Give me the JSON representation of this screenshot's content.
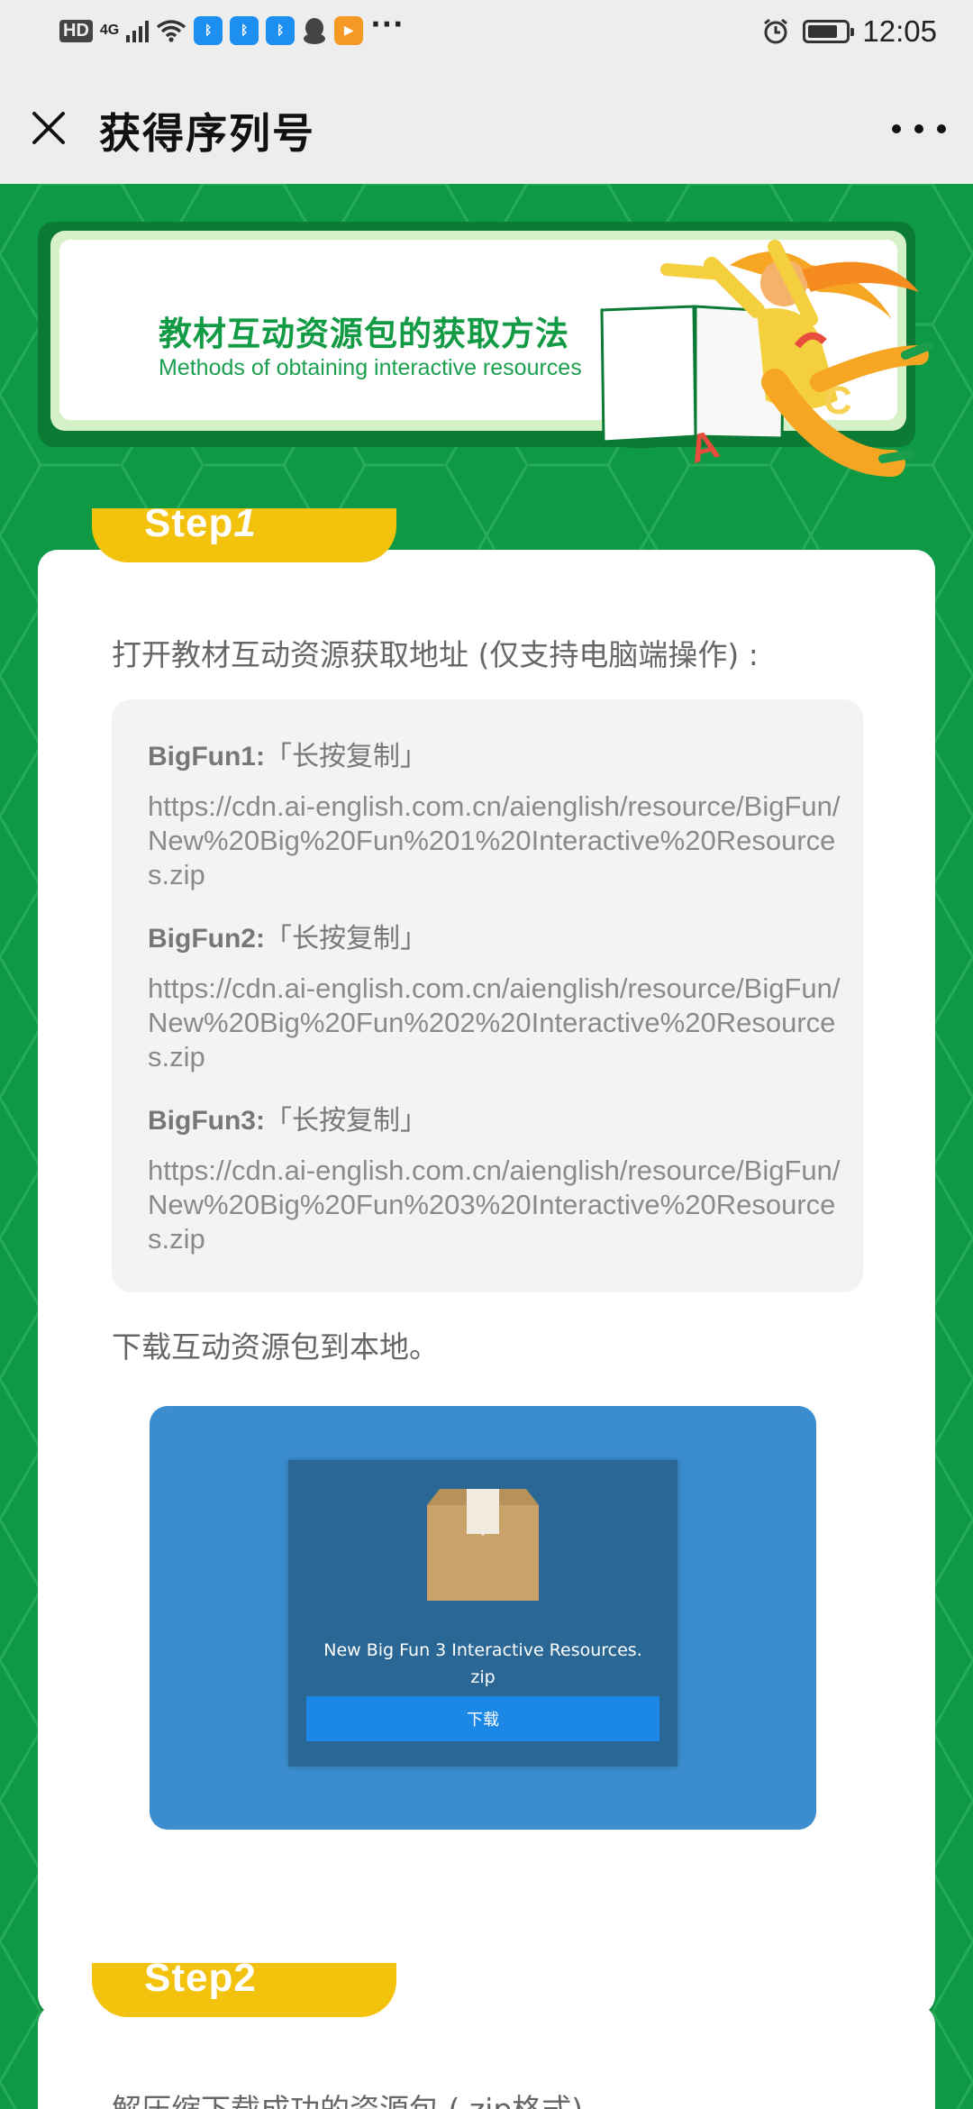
{
  "status_bar": {
    "left": {
      "hd": "HD",
      "network": "4G"
    },
    "app_badges": [
      "bluetooth-app-icon",
      "bluetooth-app-icon",
      "bluetooth-app-icon"
    ],
    "overflow": "···",
    "time": "12:05",
    "battery_level": 0.8
  },
  "nav": {
    "title": "获得序列号"
  },
  "banner": {
    "title": "教材互动资源包的获取方法",
    "subtitle": "Methods of obtaining interactive resources"
  },
  "step1": {
    "label_prefix": "Step",
    "label_number": "1",
    "intro": "打开教材互动资源获取地址 (仅支持电脑端操作) :",
    "links": [
      {
        "name": "BigFun1:",
        "hint": "「长按复制」",
        "url": "https://cdn.ai-english.com.cn/aienglish/resource/BigFun/New%20Big%20Fun%201%20Interactive%20Resources.zip"
      },
      {
        "name": "BigFun2:",
        "hint": "「长按复制」",
        "url": "https://cdn.ai-english.com.cn/aienglish/resource/BigFun/New%20Big%20Fun%202%20Interactive%20Resources.zip"
      },
      {
        "name": "BigFun3:",
        "hint": "「长按复制」",
        "url": "https://cdn.ai-english.com.cn/aienglish/resource/BigFun/New%20Big%20Fun%203%20Interactive%20Resources.zip"
      }
    ],
    "download_text": "下载互动资源包到本地。",
    "download_preview": {
      "filename_line1": "New Big Fun 3 Interactive Resources.",
      "filename_line2": "zip",
      "button_label": "下载"
    }
  },
  "step2": {
    "label_prefix": "Step",
    "label_number": "2",
    "intro": "解压缩下载成功的资源包 (.zip格式)"
  },
  "colors": {
    "page_green": "#0e9a44",
    "step_tab_yellow": "#f2c20c",
    "banner_title_green": "#129a44",
    "download_blue": "#3b8dcf"
  }
}
